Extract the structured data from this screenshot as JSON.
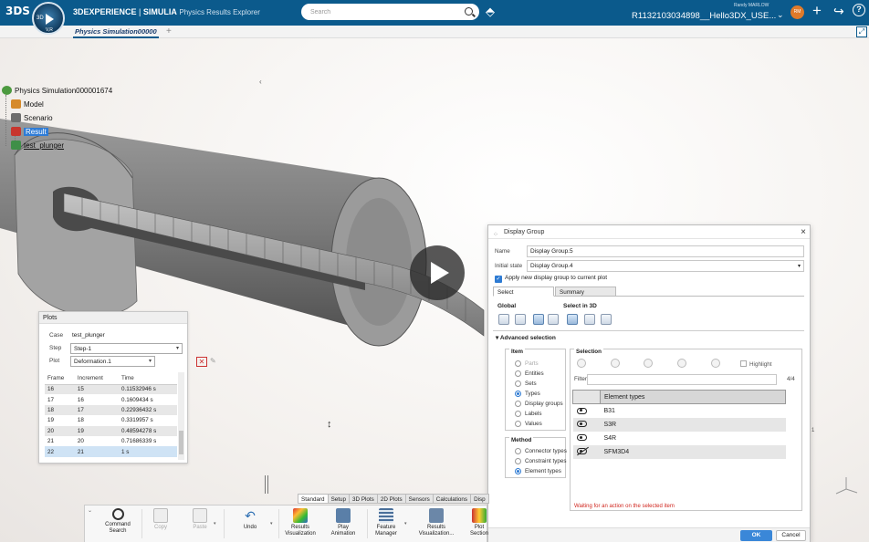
{
  "topbar": {
    "brand_logo": "3DS",
    "compass_label": "3D",
    "compass_version": "V,R",
    "app_prefix": "3DEXPERIENCE",
    "app_brand": "SIMULIA",
    "app_name": "Physics Results Explorer",
    "search_placeholder": "Search",
    "user_name": "Randy MARLOW",
    "document_name": "R1132103034898__Hello3DX_USE...",
    "avatar_initials": "RM",
    "accent_color": "#0b5a8c"
  },
  "tabs": {
    "active_tab": "Physics Simulation00000",
    "add_label": "+"
  },
  "tree": {
    "root": "Physics Simulation000001674",
    "model": "Model",
    "scenario": "Scenario",
    "result": "Result",
    "plunger": "test_plunger"
  },
  "plots": {
    "header": "Plots",
    "case_label": "Case",
    "case_value": "test_plunger",
    "step_label": "Step",
    "step_value": "Step-1",
    "plot_label": "Plot",
    "plot_value": "Deformation.1",
    "columns": [
      "Frame",
      "Increment",
      "Time"
    ],
    "rows": [
      [
        "16",
        "15",
        "0.11532946 s"
      ],
      [
        "17",
        "16",
        "0.1609434 s"
      ],
      [
        "18",
        "17",
        "0.22936432 s"
      ],
      [
        "19",
        "18",
        "0.3319957 s"
      ],
      [
        "20",
        "19",
        "0.48594278 s"
      ],
      [
        "21",
        "20",
        "0.71686339 s"
      ],
      [
        "22",
        "21",
        "1 s"
      ]
    ]
  },
  "display_group": {
    "title": "Display Group",
    "name_label": "Name",
    "name_value": "Display Group.5",
    "initial_state_label": "Initial state",
    "initial_state_value": "Display Group.4",
    "apply_label": "Apply new display group to current plot",
    "tab_select": "Select",
    "tab_summary": "Summary",
    "global_label": "Global",
    "select3d_label": "Select in 3D",
    "advanced_label": "Advanced selection",
    "item_label": "Item",
    "items": [
      "Parts",
      "Entities",
      "Sets",
      "Types",
      "Display groups",
      "Labels",
      "Values"
    ],
    "method_label": "Method",
    "methods": [
      "Connector types",
      "Constraint types",
      "Element types"
    ],
    "selection_label": "Selection",
    "highlight_label": "Highlight",
    "filter_label": "Filter",
    "filter_count": "4/4",
    "element_types_header": "Element types",
    "element_types": [
      "B31",
      "S3R",
      "S4R",
      "SFM3D4"
    ],
    "waiting_message": "Waiting for an action on the selected item",
    "ok_label": "OK",
    "cancel_label": "Cancel"
  },
  "section_tabs": [
    "Standard",
    "Setup",
    "3D Plots",
    "2D Plots",
    "Sensors",
    "Calculations",
    "Disp"
  ],
  "actions": [
    {
      "label1": "Command",
      "label2": "Search"
    },
    {
      "label1": "Copy",
      "label2": ""
    },
    {
      "label1": "Paste",
      "label2": ""
    },
    {
      "label1": "Undo",
      "label2": ""
    },
    {
      "label1": "Results",
      "label2": "Visualization"
    },
    {
      "label1": "Play",
      "label2": "Animation"
    },
    {
      "label1": "Feature",
      "label2": "Manager"
    },
    {
      "label1": "Results",
      "label2": "Visualization..."
    },
    {
      "label1": "Plot",
      "label2": "Section"
    }
  ],
  "viewport": {
    "side_marker": "1"
  }
}
